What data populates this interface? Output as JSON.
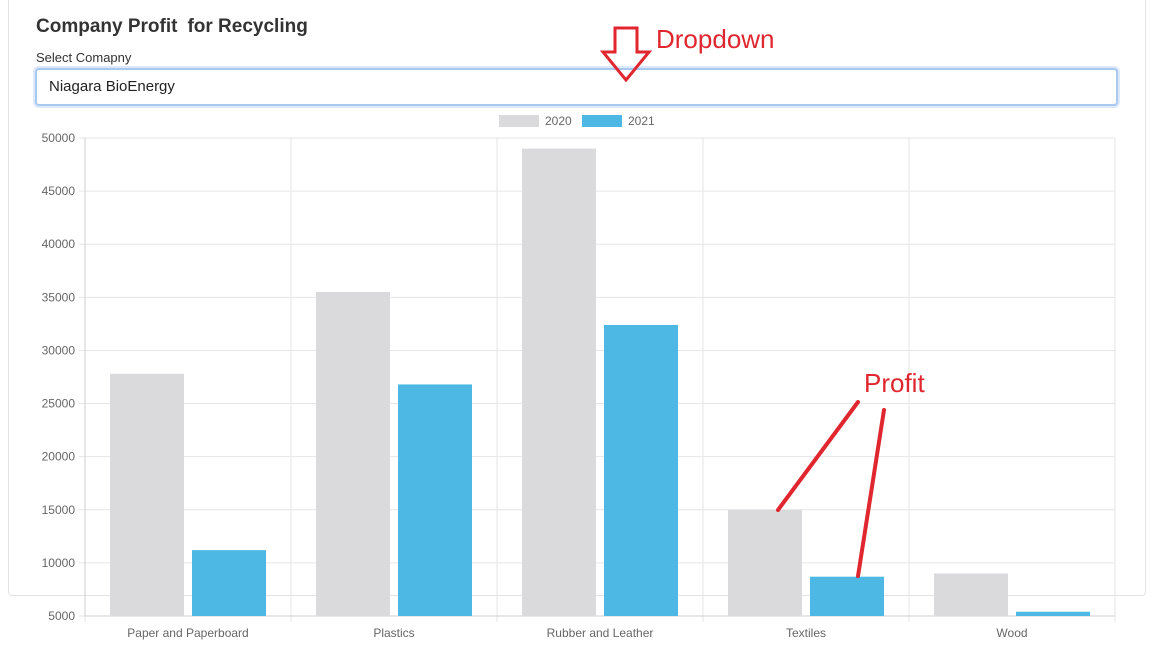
{
  "header": {
    "title": "Company Profit",
    "subtitle": "for Recycling"
  },
  "selector": {
    "label": "Select Comapny",
    "value": "Niagara BioEnergy"
  },
  "annotations": {
    "dropdown": "Dropdown",
    "profit": "Profit"
  },
  "colors": {
    "series_2020": "#dadadc",
    "series_2021": "#4db8e4",
    "annotation": "#e0262e"
  },
  "chart_data": {
    "type": "bar",
    "categories": [
      "Paper and Paperboard",
      "Plastics",
      "Rubber and Leather",
      "Textiles",
      "Wood"
    ],
    "series": [
      {
        "name": "2020",
        "values": [
          27800,
          35500,
          49000,
          15000,
          9000
        ]
      },
      {
        "name": "2021",
        "values": [
          11200,
          26800,
          32400,
          8700,
          5400
        ]
      }
    ],
    "ylim": [
      5000,
      50000
    ],
    "yticks": [
      5000,
      10000,
      15000,
      20000,
      25000,
      30000,
      35000,
      40000,
      45000,
      50000
    ],
    "legend": "top-center",
    "grid": true
  }
}
